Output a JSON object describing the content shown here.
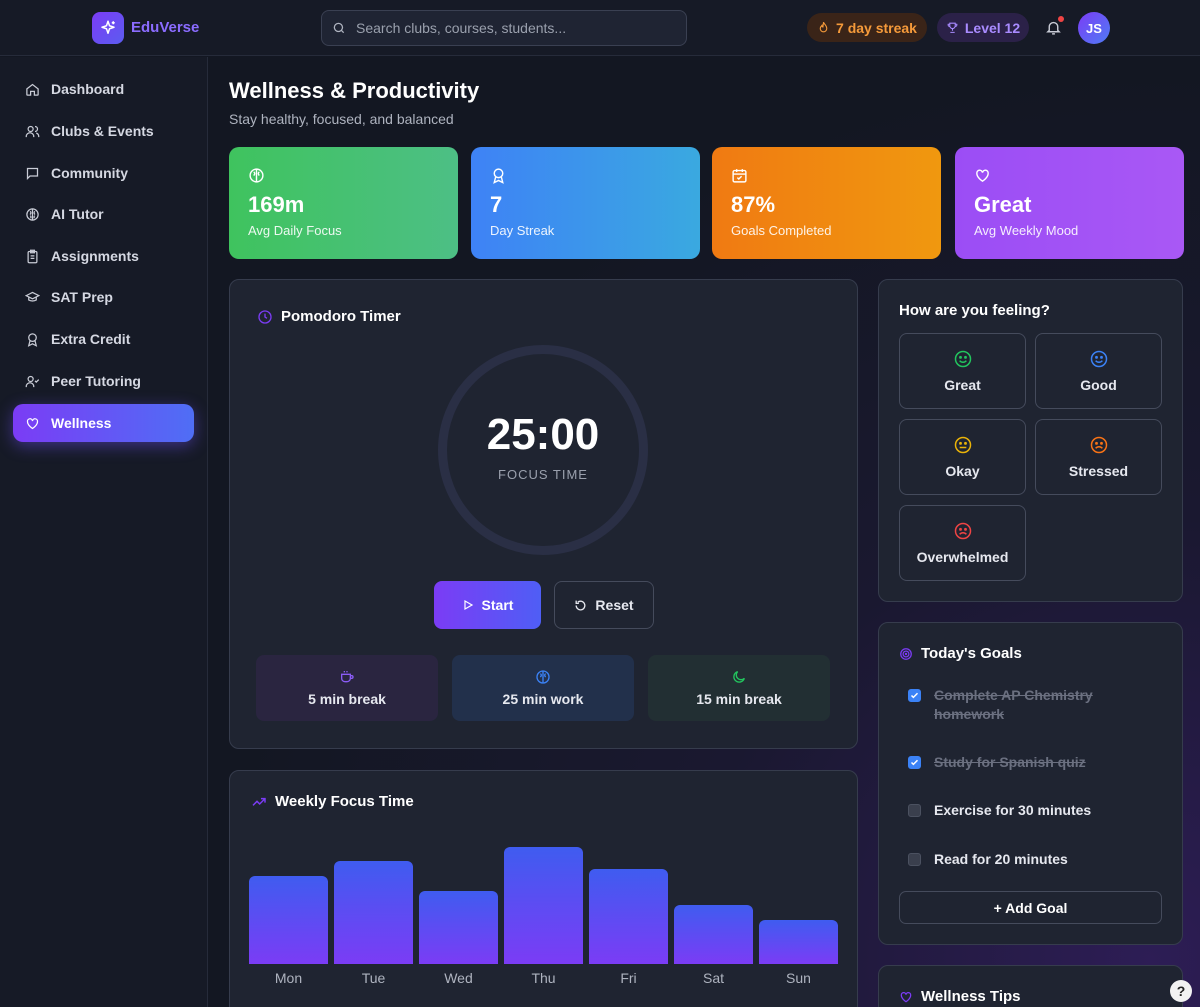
{
  "header": {
    "logo_text": "EduVerse",
    "search_placeholder": "Search clubs, courses, students...",
    "streak_label": "7 day streak",
    "level_label": "Level 12",
    "avatar_initials": "JS"
  },
  "sidebar": {
    "items": [
      {
        "label": "Dashboard",
        "icon": "home-icon"
      },
      {
        "label": "Clubs & Events",
        "icon": "users-icon"
      },
      {
        "label": "Community",
        "icon": "chat-icon"
      },
      {
        "label": "AI Tutor",
        "icon": "brain-icon"
      },
      {
        "label": "Assignments",
        "icon": "clipboard-icon"
      },
      {
        "label": "SAT Prep",
        "icon": "graduation-cap-icon"
      },
      {
        "label": "Extra Credit",
        "icon": "award-icon"
      },
      {
        "label": "Peer Tutoring",
        "icon": "user-check-icon"
      },
      {
        "label": "Wellness",
        "icon": "heart-icon"
      }
    ],
    "active": "Wellness"
  },
  "page": {
    "title": "Wellness & Productivity",
    "subtitle": "Stay healthy, focused, and balanced"
  },
  "stats": [
    {
      "value": "169m",
      "label": "Avg Daily Focus",
      "icon": "brain-icon",
      "color_from": "#3fc35e",
      "color_to": "#4dbf85"
    },
    {
      "value": "7",
      "label": "Day Streak",
      "icon": "award-icon",
      "color_from": "#3e82f6",
      "color_to": "#3aa9e0"
    },
    {
      "value": "87%",
      "label": "Goals Completed",
      "icon": "calendar-check-icon",
      "color_from": "#f07a12",
      "color_to": "#f0980f"
    },
    {
      "value": "Great",
      "label": "Avg Weekly Mood",
      "icon": "heart-icon",
      "color_from": "#9b4df5",
      "color_to": "#a958f5"
    }
  ],
  "pomodoro": {
    "title": "Pomodoro Timer",
    "time": "25:00",
    "mode": "FOCUS TIME",
    "start_label": "Start",
    "reset_label": "Reset",
    "presets": [
      {
        "label": "5 min break",
        "icon": "coffee-icon"
      },
      {
        "label": "25 min work",
        "icon": "brain-icon"
      },
      {
        "label": "15 min break",
        "icon": "moon-icon"
      }
    ]
  },
  "weekly_focus": {
    "title": "Weekly Focus Time"
  },
  "chart_data": {
    "type": "bar",
    "categories": [
      "Mon",
      "Tue",
      "Wed",
      "Thu",
      "Fri",
      "Sat",
      "Sun"
    ],
    "values": [
      155,
      182,
      130,
      207,
      168,
      104,
      78
    ],
    "title": "Weekly Focus Time",
    "xlabel": "",
    "ylabel": "",
    "ylim": [
      0,
      207
    ],
    "grid": false
  },
  "mood": {
    "title": "How are you feeling?",
    "options": [
      {
        "label": "Great",
        "color": "#22c55e",
        "face": "smile"
      },
      {
        "label": "Good",
        "color": "#3b82f6",
        "face": "smile"
      },
      {
        "label": "Okay",
        "color": "#eab308",
        "face": "meh"
      },
      {
        "label": "Stressed",
        "color": "#f97316",
        "face": "frown"
      },
      {
        "label": "Overwhelmed",
        "color": "#ef4444",
        "face": "frown"
      }
    ]
  },
  "goals": {
    "title": "Today's Goals",
    "items": [
      {
        "text": "Complete AP Chemistry homework",
        "done": true
      },
      {
        "text": "Study for Spanish quiz",
        "done": true
      },
      {
        "text": "Exercise for 30 minutes",
        "done": false
      },
      {
        "text": "Read for 20 minutes",
        "done": false
      }
    ],
    "add_label": "+ Add Goal"
  },
  "tips": {
    "title": "Wellness Tips"
  },
  "help_label": "?"
}
